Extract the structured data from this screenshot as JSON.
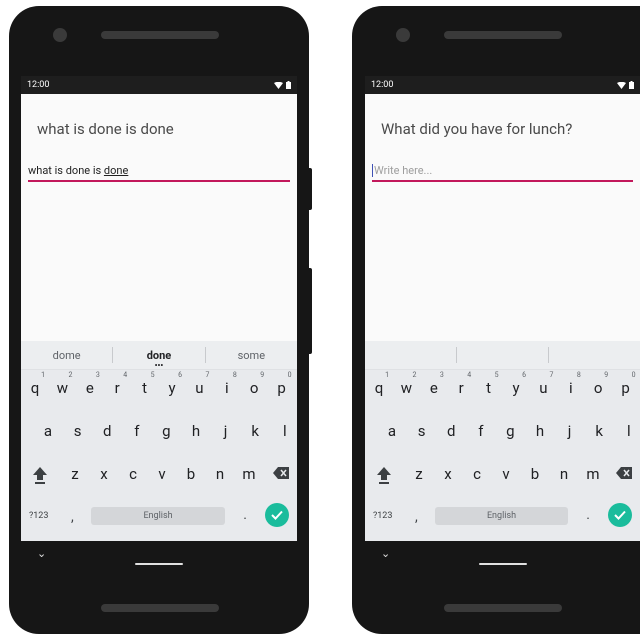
{
  "status_time": "12:00",
  "left_phone": {
    "question": "what is done is done",
    "input_text_prefix": "what is done is ",
    "input_text_underlined": "done",
    "suggestions": [
      "dome",
      "done",
      "some"
    ],
    "keyboard_language": "English"
  },
  "right_phone": {
    "question": "What did you have for lunch?",
    "input_placeholder": "Write here...",
    "keyboard_language": "English"
  },
  "keyboard": {
    "row1": [
      {
        "k": "q",
        "n": "1"
      },
      {
        "k": "w",
        "n": "2"
      },
      {
        "k": "e",
        "n": "3"
      },
      {
        "k": "r",
        "n": "4"
      },
      {
        "k": "t",
        "n": "5"
      },
      {
        "k": "y",
        "n": "6"
      },
      {
        "k": "u",
        "n": "7"
      },
      {
        "k": "i",
        "n": "8"
      },
      {
        "k": "o",
        "n": "9"
      },
      {
        "k": "p",
        "n": "0"
      }
    ],
    "row2": [
      "a",
      "s",
      "d",
      "f",
      "g",
      "h",
      "j",
      "k",
      "l"
    ],
    "row3": [
      "z",
      "x",
      "c",
      "v",
      "b",
      "n",
      "m"
    ],
    "symbols_label": "?123",
    "comma": ",",
    "period": "."
  },
  "colors": {
    "accent_line": "#c2185b",
    "enter_button": "#1abc9c",
    "phone_body": "#161616"
  }
}
